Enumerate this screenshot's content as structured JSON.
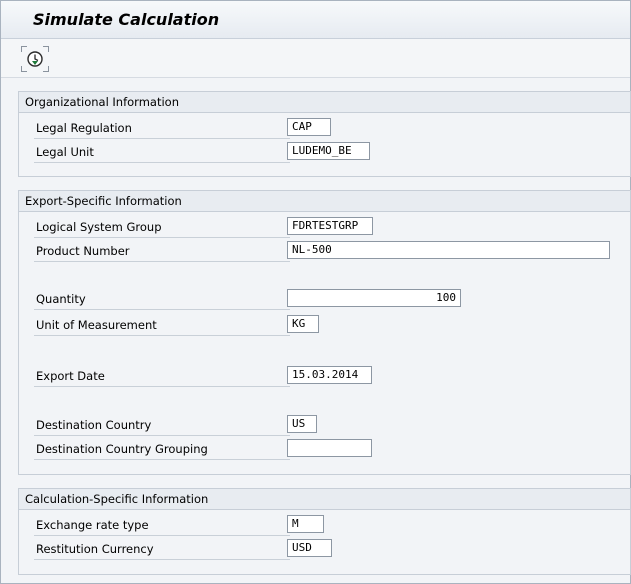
{
  "window": {
    "title": "Simulate Calculation"
  },
  "toolbar": {
    "execute_icon": "execute-clock-icon"
  },
  "groups": {
    "organizational": {
      "header": "Organizational Information",
      "legal_regulation_label": "Legal Regulation",
      "legal_regulation_value": "CAP",
      "legal_unit_label": "Legal Unit",
      "legal_unit_value": "LUDEMO_BE"
    },
    "export": {
      "header": "Export-Specific Information",
      "logical_system_group_label": "Logical System Group",
      "logical_system_group_value": "FDRTESTGRP",
      "product_number_label": "Product Number",
      "product_number_value": "NL-500",
      "quantity_label": "Quantity",
      "quantity_value": "100",
      "unit_label": "Unit of Measurement",
      "unit_value": "KG",
      "export_date_label": "Export Date",
      "export_date_value": "15.03.2014",
      "destination_country_label": "Destination Country",
      "destination_country_value": "US",
      "destination_grouping_label": "Destination Country Grouping",
      "destination_grouping_value": ""
    },
    "calculation": {
      "header": "Calculation-Specific Information",
      "exchange_rate_label": "Exchange rate type",
      "exchange_rate_value": "M",
      "currency_label": "Restitution Currency",
      "currency_value": "USD"
    }
  }
}
